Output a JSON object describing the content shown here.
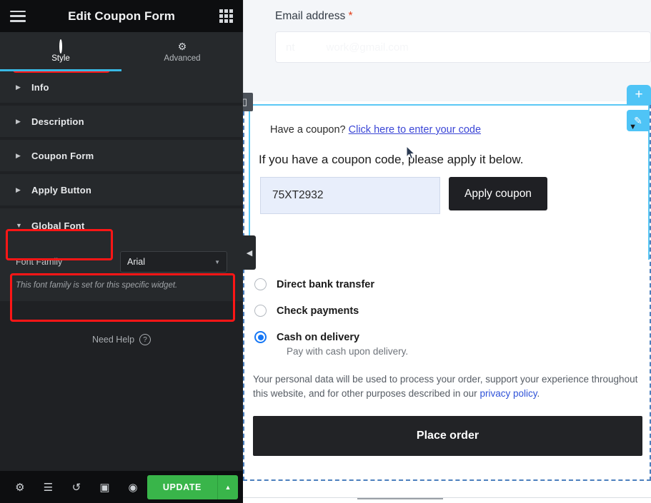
{
  "panel": {
    "title": "Edit Coupon Form",
    "menu_icon": "hamburger-icon",
    "apps_icon": "grid-icon",
    "tabs": [
      {
        "label": "Style",
        "icon": "contrast-icon",
        "active": true
      },
      {
        "label": "Advanced",
        "icon": "gear-icon",
        "active": false
      }
    ],
    "sections": [
      {
        "label": "Info",
        "expanded": false,
        "arrow": "▶"
      },
      {
        "label": "Description",
        "expanded": false,
        "arrow": "▶"
      },
      {
        "label": "Coupon Form",
        "expanded": false,
        "arrow": "▶"
      },
      {
        "label": "Apply Button",
        "expanded": false,
        "arrow": "▶"
      },
      {
        "label": "Global Font",
        "expanded": true,
        "arrow": "▼"
      }
    ],
    "font_control": {
      "label": "Font Family",
      "value": "Arial",
      "caret": "▼",
      "description": "This font family is set for this specific widget."
    },
    "need_help": {
      "label": "Need Help",
      "icon": "question-circle-icon",
      "glyph": "?"
    },
    "footer": {
      "icons": [
        {
          "name": "settings-gear-icon",
          "glyph": "⚙"
        },
        {
          "name": "navigator-layers-icon",
          "glyph": "☰"
        },
        {
          "name": "history-revisions-icon",
          "glyph": "↺"
        },
        {
          "name": "responsive-mode-icon",
          "glyph": "▣"
        },
        {
          "name": "preview-eye-icon",
          "glyph": "◉"
        }
      ],
      "update_label": "UPDATE",
      "update_caret": "▲"
    },
    "colors": {
      "panel_bg": "#1f2124",
      "section_bg": "#26292c",
      "header_bg": "#0d0e10",
      "accent_blue": "#39b9e5",
      "update_green": "#39b54a",
      "annotation_red": "#ff1616"
    }
  },
  "canvas": {
    "email": {
      "label": "Email address",
      "required_mark": "*",
      "placeholder_left": "nt",
      "placeholder_right": "work@gmail.com"
    },
    "add_section_button": "+",
    "column_handle_icon": "columns-icon",
    "edit_widget_icon": "pencil-icon",
    "widget_caret": "▼",
    "coupon": {
      "prompt": "Have a coupon?",
      "link": "Click here to enter your code",
      "description": "If you have a coupon code, please apply it below.",
      "code_value": "75XT2932",
      "apply_label": "Apply coupon"
    },
    "payment_methods": [
      {
        "label": "Direct bank transfer",
        "selected": false
      },
      {
        "label": "Check payments",
        "selected": false
      },
      {
        "label": "Cash on delivery",
        "selected": true
      }
    ],
    "payment_note": "Pay with cash upon delivery.",
    "privacy": {
      "text": "Your personal data will be used to process your order, support your experience throughout this website, and for other purposes described in our ",
      "link": "privacy policy",
      "suffix": "."
    },
    "place_order_label": "Place order",
    "collapse_icon": "◀",
    "colors": {
      "section_bg": "#f4f6f9",
      "coupon_input_bg": "#e8eefb",
      "button_dark": "#1f2024",
      "radio_blue": "#1677f5",
      "link_blue": "#3b46d6",
      "widget_blue": "#4fc4f6",
      "dashed_border": "#4b7fbd"
    }
  }
}
